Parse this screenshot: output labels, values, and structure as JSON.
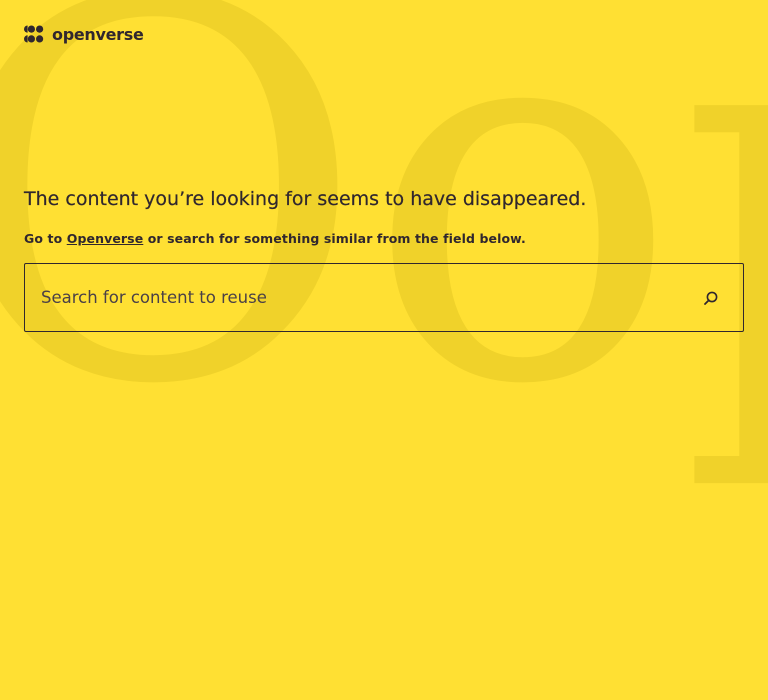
{
  "brand": {
    "name": "openverse",
    "logo_icon": "openverse-logo-icon"
  },
  "background": {
    "decorative_text": "Oops"
  },
  "error": {
    "headline": "The content you’re looking for seems to have disappeared.",
    "prefix": "Go to",
    "link_label": "Openverse",
    "suffix": "or search for something similar from the field below."
  },
  "search": {
    "placeholder": "Search for content to reuse",
    "value": "",
    "button_icon": "search-icon"
  },
  "colors": {
    "background": "#ffe033",
    "text": "#30272e",
    "watermark": "#f0d22a"
  }
}
